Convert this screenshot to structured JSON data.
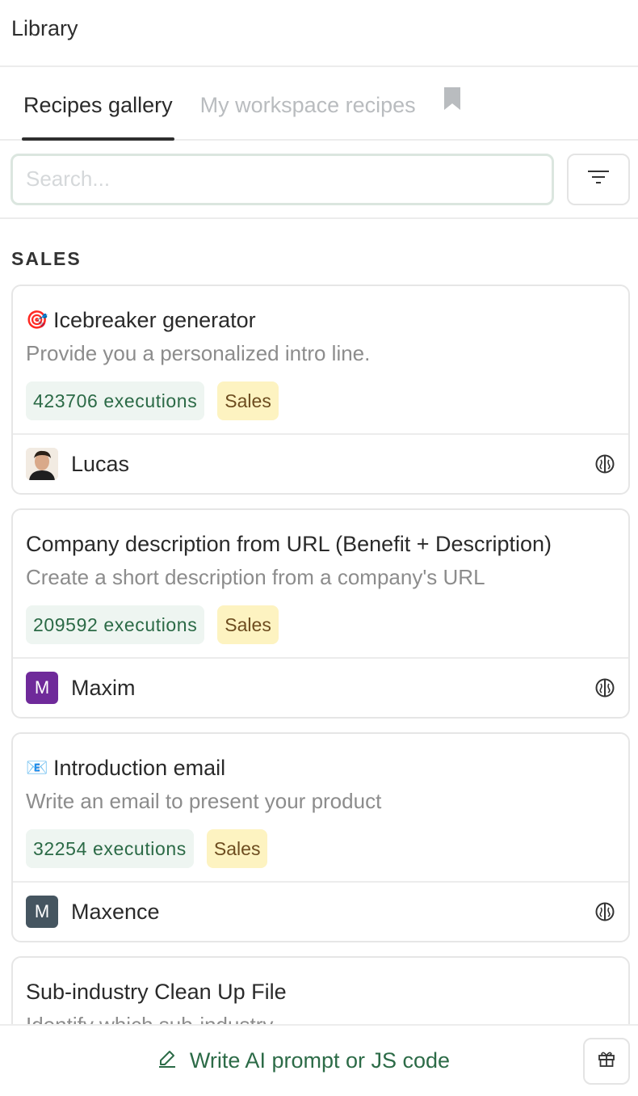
{
  "header": {
    "title": "Library"
  },
  "tabs": [
    {
      "label": "Recipes gallery",
      "active": true
    },
    {
      "label": "My workspace recipes",
      "active": false
    }
  ],
  "search": {
    "placeholder": "Search...",
    "value": ""
  },
  "section": {
    "label": "SALES"
  },
  "cards": [
    {
      "emoji": "🎯",
      "title": "Icebreaker generator",
      "description": "Provide you a personalized intro line.",
      "executions": "423706 executions",
      "category": "Sales",
      "author": "Lucas",
      "avatar_type": "photo",
      "avatar_initial": "",
      "avatar_color": "#e8d8c8"
    },
    {
      "emoji": "",
      "title": "Company description from URL (Benefit + Description)",
      "description": "Create a short description from a company's URL",
      "executions": "209592 executions",
      "category": "Sales",
      "author": "Maxim",
      "avatar_type": "initial",
      "avatar_initial": "M",
      "avatar_color": "#6f2a9a"
    },
    {
      "emoji": "📧",
      "title": "Introduction email",
      "description": "Write an email to present your product",
      "executions": "32254 executions",
      "category": "Sales",
      "author": "Maxence",
      "avatar_type": "initial",
      "avatar_initial": "M",
      "avatar_color": "#455560"
    },
    {
      "emoji": "",
      "title": "Sub-industry Clean Up File",
      "description": "Identify which sub-industry",
      "executions": "",
      "category": "",
      "author": "",
      "avatar_type": "",
      "avatar_initial": "",
      "avatar_color": ""
    }
  ],
  "bottom": {
    "write_label": "Write AI prompt or JS code"
  },
  "colors": {
    "accent_green": "#2c6b47",
    "exec_badge_bg": "#eef5f1",
    "category_badge_bg": "#fdf3c1",
    "search_border": "#dbe6df"
  },
  "icons": [
    "bookmark-icon",
    "filter-icon",
    "brain-icon",
    "pencil-icon",
    "gift-icon",
    "target-emoji",
    "envelope-emoji"
  ]
}
